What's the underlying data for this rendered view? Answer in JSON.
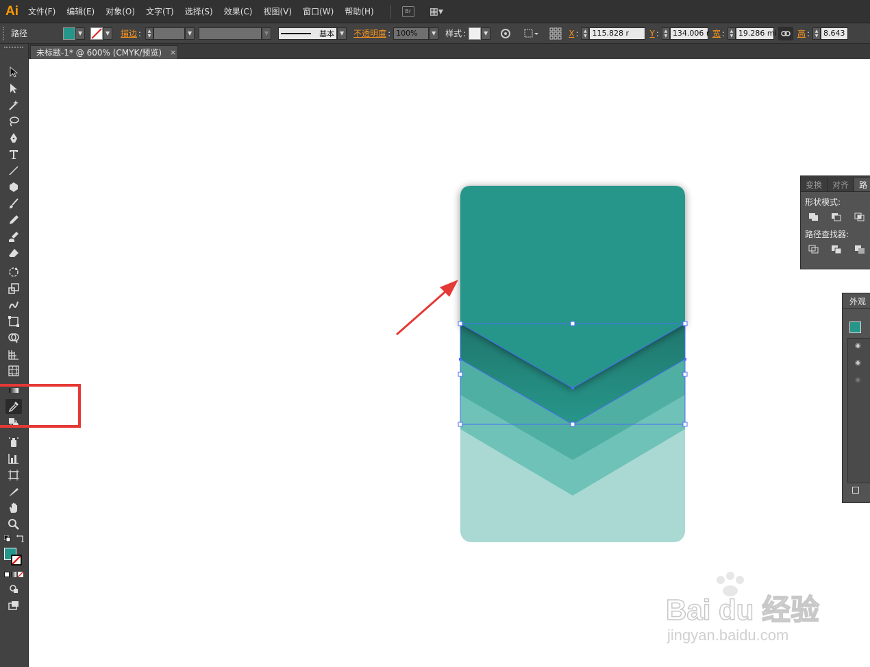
{
  "app": {
    "logo": "Ai"
  },
  "menu": [
    "文件(F)",
    "编辑(E)",
    "对象(O)",
    "文字(T)",
    "选择(S)",
    "效果(C)",
    "视图(V)",
    "窗口(W)",
    "帮助(H)"
  ],
  "menu_extra": {
    "bridge_label": "Br"
  },
  "control": {
    "object_type": "路径",
    "fill_color": "#26968a",
    "stroke_label": "描边",
    "stroke_style_label": "基本",
    "opacity_label": "不透明度",
    "opacity_value": "100%",
    "style_label": "样式",
    "x_label": "X",
    "x_value": "115.828 r",
    "y_label": "Y",
    "y_value": "134.006 r",
    "w_label": "宽",
    "w_value": "19.286 mi",
    "h_label": "高",
    "h_value": "8.643"
  },
  "document": {
    "tab_title": "未标题-1* @ 600% (CMYK/预览)",
    "close_glyph": "×"
  },
  "tools": [
    "selection-tool",
    "direct-selection-tool",
    "magic-wand-tool",
    "lasso-tool",
    "pen-tool",
    "type-tool",
    "line-tool",
    "polygon-tool",
    "paintbrush-tool",
    "pencil-tool",
    "blob-brush-tool",
    "eraser-tool",
    "rotate-tool",
    "scale-tool",
    "warp-tool",
    "free-transform-tool",
    "shape-builder-tool",
    "perspective-grid-tool",
    "mesh-tool",
    "gradient-tool",
    "eyedropper-tool",
    "blend-tool",
    "symbol-sprayer-tool",
    "column-graph-tool",
    "artboard-tool",
    "slice-tool",
    "hand-tool",
    "zoom-tool"
  ],
  "pathfinder_panel": {
    "tabs": [
      "变换",
      "对齐",
      "路"
    ],
    "shape_modes_label": "形状模式:",
    "pathfinders_label": "路径查找器:"
  },
  "appearance_panel": {
    "title": "外观"
  },
  "watermark": {
    "line1": "Bai du 经验",
    "line2": "jingyan.baidu.com"
  },
  "colors": {
    "card_dark": "#27968a",
    "chevron_mid": "#4fafa3",
    "chevron_light": "#6fc2b7",
    "card_light": "#aad9d4",
    "selection": "#4a6cf7",
    "highlight": "#e53935"
  }
}
